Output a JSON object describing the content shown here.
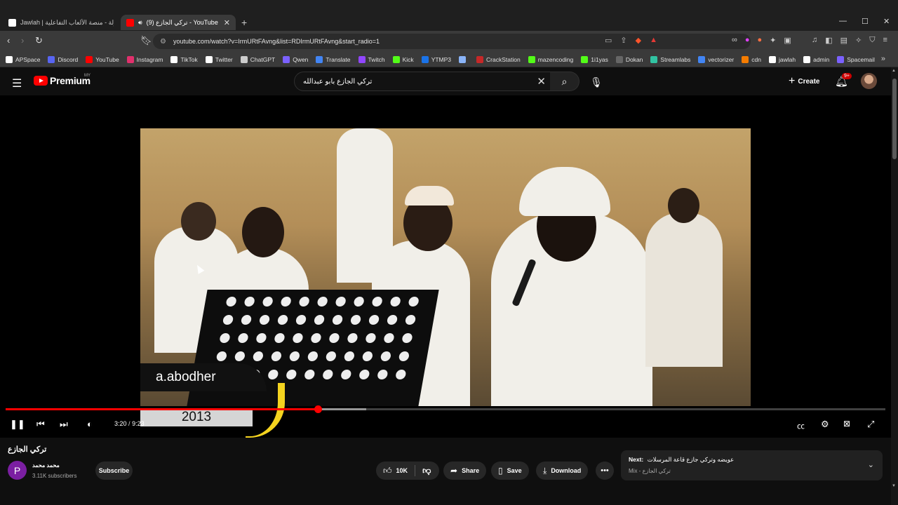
{
  "browser": {
    "tabs": [
      {
        "title": "Jawlah | جولة - منصة الألعاب التفاعلية",
        "active": false,
        "favicon_color": "#ffffff"
      },
      {
        "title": "(9) تركي الجازع - YouTube",
        "active": true,
        "favicon_color": "#ff0000"
      }
    ],
    "url": "youtube.com/watch?v=IrmURtFAvng&list=RDIrmURtFAvng&start_radio=1",
    "bookmarks": [
      {
        "label": "APSpace",
        "color": "#ffffff"
      },
      {
        "label": "Discord",
        "color": "#5865f2"
      },
      {
        "label": "YouTube",
        "color": "#ff0000"
      },
      {
        "label": "Instagram",
        "color": "#e1306c"
      },
      {
        "label": "TikTok",
        "color": "#ffffff"
      },
      {
        "label": "Twitter",
        "color": "#ffffff"
      },
      {
        "label": "ChatGPT",
        "color": "#cccccc"
      },
      {
        "label": "Qwen",
        "color": "#7b61ff"
      },
      {
        "label": "Translate",
        "color": "#4285f4"
      },
      {
        "label": "Twitch",
        "color": "#9146ff"
      },
      {
        "label": "Kick",
        "color": "#53fc18"
      },
      {
        "label": "YTMP3",
        "color": "#1a73e8"
      },
      {
        "label": "",
        "color": "#8ab4f8"
      },
      {
        "label": "CrackStation",
        "color": "#c62828"
      },
      {
        "label": "mazencoding",
        "color": "#53fc18"
      },
      {
        "label": "1i1yas",
        "color": "#53fc18"
      },
      {
        "label": "Dokan",
        "color": "#666666"
      },
      {
        "label": "Streamlabs",
        "color": "#31c3a2"
      },
      {
        "label": "vectorizer",
        "color": "#4285f4"
      },
      {
        "label": "cdn",
        "color": "#f57c00"
      },
      {
        "label": "jawlah",
        "color": "#ffffff"
      },
      {
        "label": "admin",
        "color": "#ffffff"
      },
      {
        "label": "Spacemail",
        "color": "#7b61ff"
      }
    ]
  },
  "youtube": {
    "logo_text": "Premium",
    "logo_country": "MY",
    "search_value": "تركي الجازع بابو عبدالله",
    "create_label": "Create",
    "notif_count": "9+",
    "player": {
      "watermark_name": "a.abodher",
      "watermark_year": "2013",
      "current_time": "3:20",
      "separator": "/",
      "duration": "9:23",
      "progress_fraction": 0.355,
      "buffered_fraction": 0.41
    },
    "video_title": "تركي الجازع",
    "channel": {
      "initial": "P",
      "name": "محمد محمد",
      "subscribers": "3.11K subscribers"
    },
    "subscribe_label": "Subscribe",
    "likes": "10K",
    "share_label": "Share",
    "save_label": "Save",
    "download_label": "Download",
    "next": {
      "label": "Next:",
      "title": "عويضه وتركي جازع قاعة المرسلات",
      "mix_label": "Mix -",
      "mix_title": "تركي الجازع"
    }
  }
}
